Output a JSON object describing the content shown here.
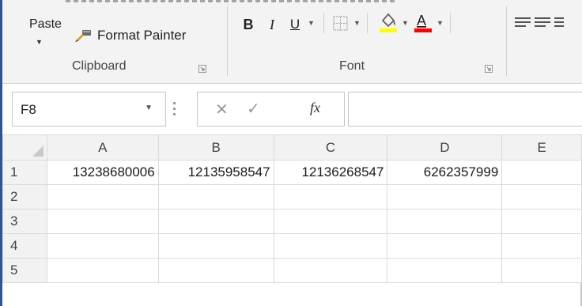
{
  "ribbon": {
    "clipboard": {
      "paste_label": "Paste",
      "format_painter_label": "Format Painter",
      "group_label": "Clipboard"
    },
    "font": {
      "group_label": "Font",
      "bold_label": "B",
      "italic_label": "I",
      "underline_label": "U",
      "highlight_color": "#ffff00",
      "font_color": "#ff0000"
    }
  },
  "formula_bar": {
    "name_box": "F8",
    "cancel_glyph": "✕",
    "enter_glyph": "✓",
    "fx_label": "fx",
    "formula": ""
  },
  "sheet": {
    "columns": [
      "A",
      "B",
      "C",
      "D",
      "E"
    ],
    "rows": [
      {
        "label": "1",
        "cells": [
          "13238680006",
          "12135958547",
          "12136268547",
          "6262357999",
          ""
        ]
      },
      {
        "label": "2",
        "cells": [
          "",
          "",
          "",
          "",
          ""
        ]
      },
      {
        "label": "3",
        "cells": [
          "",
          "",
          "",
          "",
          ""
        ]
      },
      {
        "label": "4",
        "cells": [
          "",
          "",
          "",
          "",
          ""
        ]
      },
      {
        "label": "5",
        "cells": [
          "",
          "",
          "",
          "",
          ""
        ]
      }
    ]
  },
  "colors": {
    "frame_accent": "#2b579a",
    "header_bg": "#f2f2f2",
    "gridline": "#dadada"
  }
}
